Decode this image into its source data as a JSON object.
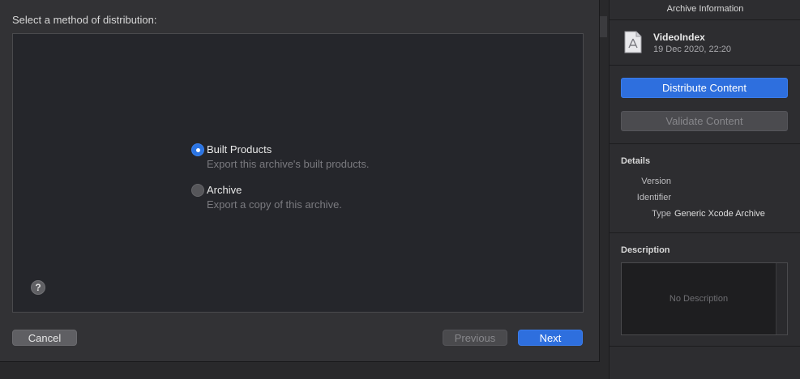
{
  "sheet": {
    "title": "Select a method of distribution:",
    "options": [
      {
        "label": "Built Products",
        "description": "Export this archive's built products.",
        "selected": true
      },
      {
        "label": "Archive",
        "description": "Export a copy of this archive.",
        "selected": false
      }
    ],
    "help_label": "?",
    "buttons": {
      "cancel": "Cancel",
      "previous": "Previous",
      "next": "Next"
    }
  },
  "inspector": {
    "header": "Archive Information",
    "archive": {
      "name": "VideoIndex",
      "date": "19 Dec 2020, 22:20",
      "icon": "archive-file-icon"
    },
    "buttons": {
      "distribute": "Distribute Content",
      "validate": "Validate Content"
    },
    "details": {
      "title": "Details",
      "rows": [
        {
          "key": "Version",
          "value": ""
        },
        {
          "key": "Identifier",
          "value": ""
        },
        {
          "key": "Type",
          "value": "Generic Xcode Archive"
        }
      ]
    },
    "description": {
      "title": "Description",
      "placeholder": "No Description"
    }
  },
  "colors": {
    "accent": "#2e6fde",
    "background": "#29292b",
    "panel": "#2d2d30"
  }
}
